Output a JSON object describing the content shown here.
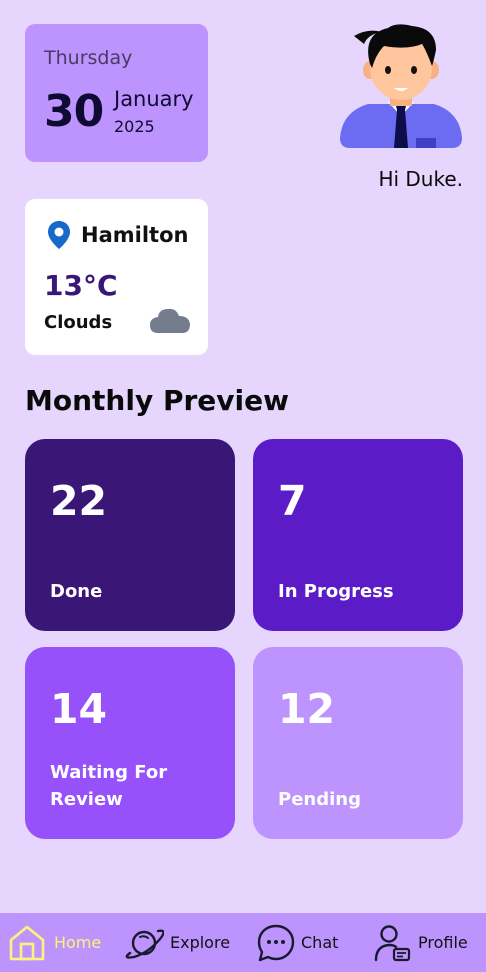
{
  "date": {
    "weekday": "Thursday",
    "day": "30",
    "month": "January",
    "year": "2025"
  },
  "greeting": "Hi Duke.",
  "weather": {
    "city": "Hamilton",
    "temperature": "13°C",
    "condition": "Clouds",
    "icon": "cloud-icon"
  },
  "section_title": "Monthly Preview",
  "stats": [
    {
      "count": "22",
      "label": "Done",
      "color": "#3a1677"
    },
    {
      "count": "7",
      "label": "In Progress",
      "color": "#5b1cc8"
    },
    {
      "count": "14",
      "label": "Waiting For Review",
      "color": "#9651fb"
    },
    {
      "count": "12",
      "label": "Pending",
      "color": "#bd94fe"
    }
  ],
  "nav": [
    {
      "label": "Home",
      "icon": "home-icon",
      "active": true
    },
    {
      "label": "Explore",
      "icon": "planet-icon",
      "active": false
    },
    {
      "label": "Chat",
      "icon": "chat-bubble-icon",
      "active": false
    },
    {
      "label": "Profile",
      "icon": "profile-icon",
      "active": false
    }
  ],
  "colors": {
    "background": "#e6d5fd",
    "accent_light": "#bd94fe",
    "accent_dark": "#3a1677",
    "active_nav": "#fff27a"
  }
}
